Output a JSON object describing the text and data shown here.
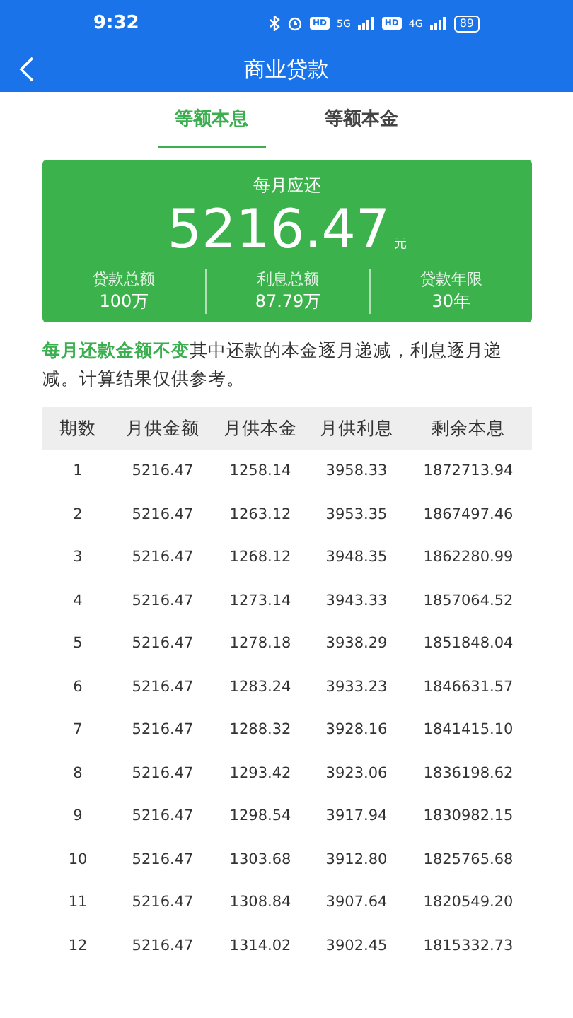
{
  "status_bar": {
    "time": "9:32",
    "networks": [
      {
        "badge": "HD",
        "type": "5G"
      },
      {
        "badge": "HD",
        "type": "4G"
      }
    ],
    "battery": "89"
  },
  "header": {
    "title": "商业贷款"
  },
  "tabs": [
    {
      "label": "等额本息",
      "selected": true
    },
    {
      "label": "等额本金",
      "selected": false
    }
  ],
  "summary": {
    "caption": "每月应还",
    "amount": "5216.47",
    "unit": "元",
    "stats": [
      {
        "label": "贷款总额",
        "value": "100万"
      },
      {
        "label": "利息总额",
        "value": "87.79万"
      },
      {
        "label": "贷款年限",
        "value": "30年"
      }
    ]
  },
  "note": {
    "highlight": "每月还款金额不变",
    "text": "其中还款的本金逐月递减，利息逐月递减。计算结果仅供参考。"
  },
  "table": {
    "columns": [
      "期数",
      "月供金额",
      "月供本金",
      "月供利息",
      "剩余本息"
    ],
    "rows": [
      [
        "1",
        "5216.47",
        "1258.14",
        "3958.33",
        "1872713.94"
      ],
      [
        "2",
        "5216.47",
        "1263.12",
        "3953.35",
        "1867497.46"
      ],
      [
        "3",
        "5216.47",
        "1268.12",
        "3948.35",
        "1862280.99"
      ],
      [
        "4",
        "5216.47",
        "1273.14",
        "3943.33",
        "1857064.52"
      ],
      [
        "5",
        "5216.47",
        "1278.18",
        "3938.29",
        "1851848.04"
      ],
      [
        "6",
        "5216.47",
        "1283.24",
        "3933.23",
        "1846631.57"
      ],
      [
        "7",
        "5216.47",
        "1288.32",
        "3928.16",
        "1841415.10"
      ],
      [
        "8",
        "5216.47",
        "1293.42",
        "3923.06",
        "1836198.62"
      ],
      [
        "9",
        "5216.47",
        "1298.54",
        "3917.94",
        "1830982.15"
      ],
      [
        "10",
        "5216.47",
        "1303.68",
        "3912.80",
        "1825765.68"
      ],
      [
        "11",
        "5216.47",
        "1308.84",
        "3907.64",
        "1820549.20"
      ],
      [
        "12",
        "5216.47",
        "1314.02",
        "3902.45",
        "1815332.73"
      ]
    ]
  }
}
